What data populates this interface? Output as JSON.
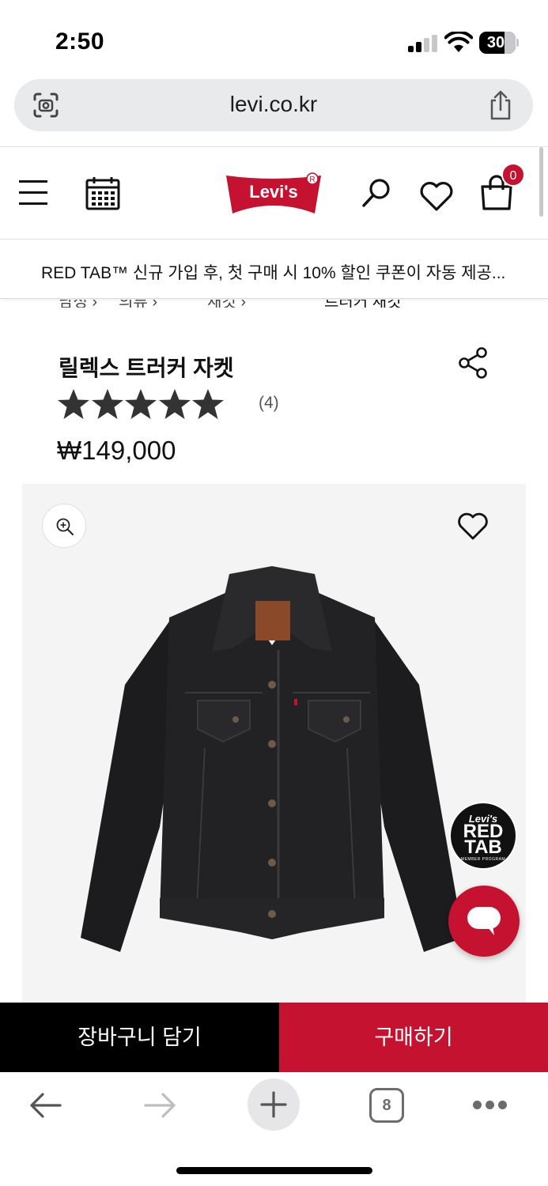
{
  "status_bar": {
    "time": "2:50",
    "battery": "30"
  },
  "browser": {
    "url": "levi.co.kr",
    "open_tabs": "8"
  },
  "header": {
    "logo_text": "Levi's",
    "cart_count": "0"
  },
  "promo": {
    "text": "RED TAB™ 신규 가입 후, 첫 구매 시 10% 할인 쿠폰이 자동 제공..."
  },
  "product": {
    "title": "릴렉스 트러커 자켓",
    "rating": 5,
    "rating_max": 5,
    "review_count": "(4)",
    "price": "₩149,000"
  },
  "red_tab_badge": {
    "brand": "Levi's",
    "line1": "RED",
    "line2": "TAB",
    "sub": "MEMBER PROGRAM"
  },
  "actions": {
    "add_to_cart": "장바구니 담기",
    "buy_now": "구매하기"
  },
  "icons": {
    "lens": "camera-search-icon",
    "share": "share-icon",
    "menu": "hamburger-menu-icon",
    "calendar": "calendar-icon",
    "search": "search-icon",
    "wishlist": "heart-icon",
    "cart": "shopping-bag-icon",
    "zoom": "zoom-in-icon",
    "chat": "chat-bubble-icon",
    "back": "arrow-left-icon",
    "forward": "arrow-right-icon",
    "new_tab": "plus-icon",
    "more": "more-dots-icon"
  },
  "colors": {
    "brand_red": "#c41230",
    "black": "#000000",
    "image_bg": "#f4f4f4"
  }
}
